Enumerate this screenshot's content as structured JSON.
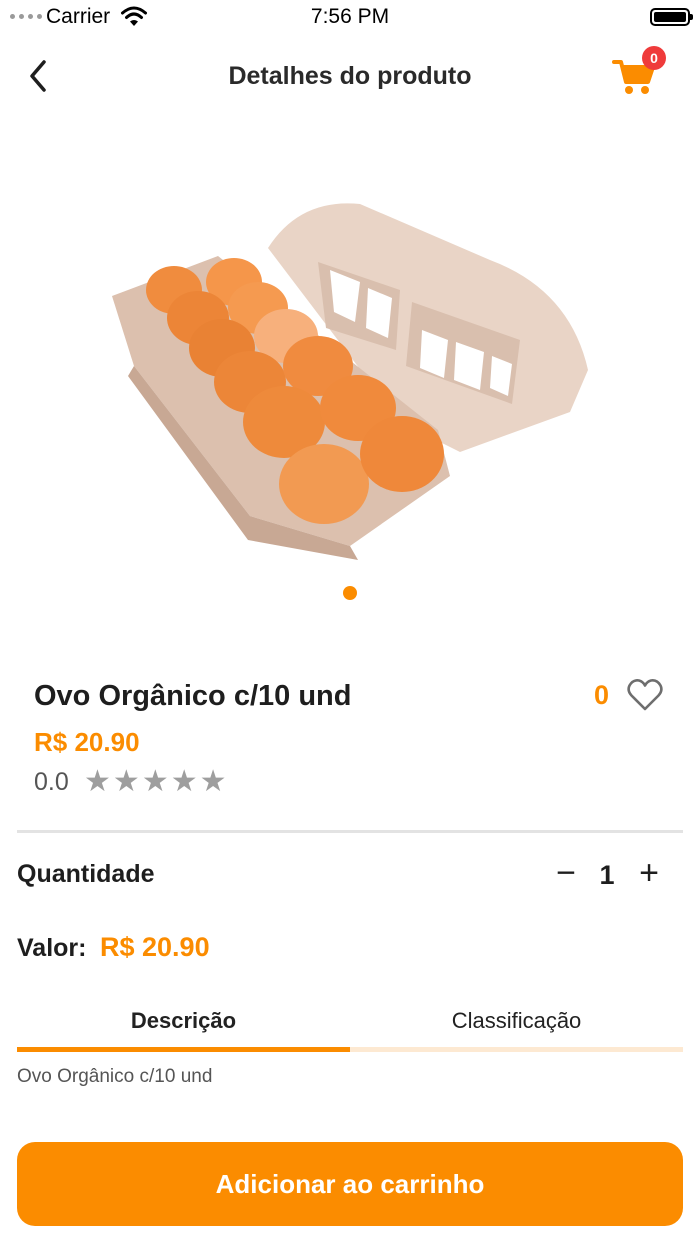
{
  "status_bar": {
    "carrier": "Carrier",
    "time": "7:56 PM"
  },
  "nav": {
    "title": "Detalhes do produto",
    "cart_count": "0"
  },
  "product": {
    "name": "Ovo Orgânico c/10 und",
    "likes": "0",
    "price": "R$ 20.90",
    "rating_text": "0.0",
    "rating": 0,
    "rating_max": 5,
    "image_icon": "egg-carton-image"
  },
  "quantity": {
    "label": "Quantidade",
    "value": "1",
    "minus": "−",
    "plus": "+"
  },
  "total": {
    "label": "Valor:",
    "amount": "R$ 20.90"
  },
  "tabs": {
    "items": [
      {
        "label": "Descrição"
      },
      {
        "label": "Classificação"
      }
    ],
    "active": 0,
    "description": "Ovo Orgânico c/10 und"
  },
  "actions": {
    "add_to_cart": "Adicionar ao carrinho"
  },
  "colors": {
    "accent": "#fb8c00",
    "badge": "#ef3b3b",
    "star_inactive": "#9e9e9e"
  }
}
